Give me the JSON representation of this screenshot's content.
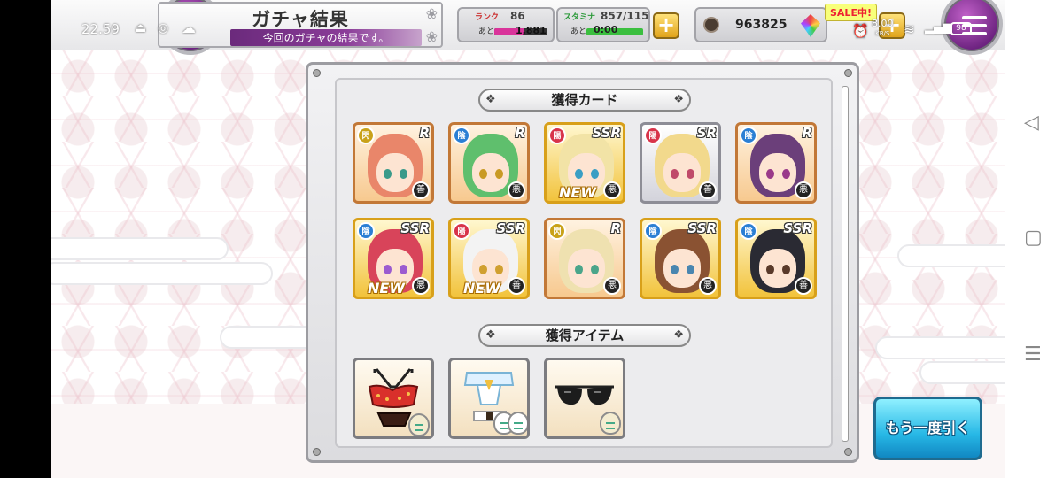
{
  "status_bar": {
    "time": "22.59",
    "net_speed": "8.00",
    "net_unit": "KB/S",
    "battery": "98"
  },
  "header": {
    "title": "ガチャ結果",
    "subtitle": "今回のガチャの結果です。",
    "rank_label": "ランク",
    "rank_value": "86",
    "rank_remain_label": "あと",
    "rank_remain_value": "1,881",
    "rank_progress": 0.55,
    "stamina_label": "スタミナ",
    "stamina_value": "857/115",
    "stamina_remain_label": "あと",
    "stamina_remain_value": "0:00",
    "stamina_progress": 1.0,
    "coins": "963825",
    "sale_badge": "SALE中!"
  },
  "sections": {
    "cards_title": "獲得カード",
    "items_title": "獲得アイテム"
  },
  "cards": [
    {
      "rarity": "R",
      "element": "閃",
      "side": "善",
      "is_new": false,
      "hair": "#e9866a",
      "eyes": "#3a9a8a"
    },
    {
      "rarity": "R",
      "element": "陰",
      "side": "悪",
      "is_new": false,
      "hair": "#5fbf6d",
      "eyes": "#c99a24"
    },
    {
      "rarity": "SSR",
      "element": "陽",
      "side": "悪",
      "is_new": true,
      "hair": "#f2e3a6",
      "eyes": "#3a9ec4"
    },
    {
      "rarity": "SR",
      "element": "陽",
      "side": "善",
      "is_new": false,
      "hair": "#f2d98c",
      "eyes": "#c04a6a"
    },
    {
      "rarity": "R",
      "element": "陰",
      "side": "悪",
      "is_new": false,
      "hair": "#6b3f7a",
      "eyes": "#9a3a8a"
    },
    {
      "rarity": "SSR",
      "element": "陰",
      "side": "悪",
      "is_new": true,
      "hair": "#d8445a",
      "eyes": "#9b5bd0"
    },
    {
      "rarity": "SSR",
      "element": "陽",
      "side": "善",
      "is_new": true,
      "hair": "#f3f3f3",
      "eyes": "#d0a030"
    },
    {
      "rarity": "R",
      "element": "閃",
      "side": "悪",
      "is_new": false,
      "hair": "#efe1b0",
      "eyes": "#4aa58a"
    },
    {
      "rarity": "SSR",
      "element": "陰",
      "side": "悪",
      "is_new": false,
      "hair": "#8a5232",
      "eyes": "#4a86b0"
    },
    {
      "rarity": "SSR",
      "element": "陰",
      "side": "善",
      "is_new": false,
      "hair": "#2a2a33",
      "eyes": "#5a3a2a"
    }
  ],
  "new_label": "NEW",
  "items": [
    {
      "name": "red-bikini-icon"
    },
    {
      "name": "white-outfit-icon"
    },
    {
      "name": "sunglasses-icon"
    }
  ],
  "again_button": "もう一度引く",
  "colors": {
    "accent_purple": "#7a2a8c",
    "element_yin": "#2b7fd4",
    "element_yang": "#d8344a",
    "element_flash": "#c9a21a"
  }
}
